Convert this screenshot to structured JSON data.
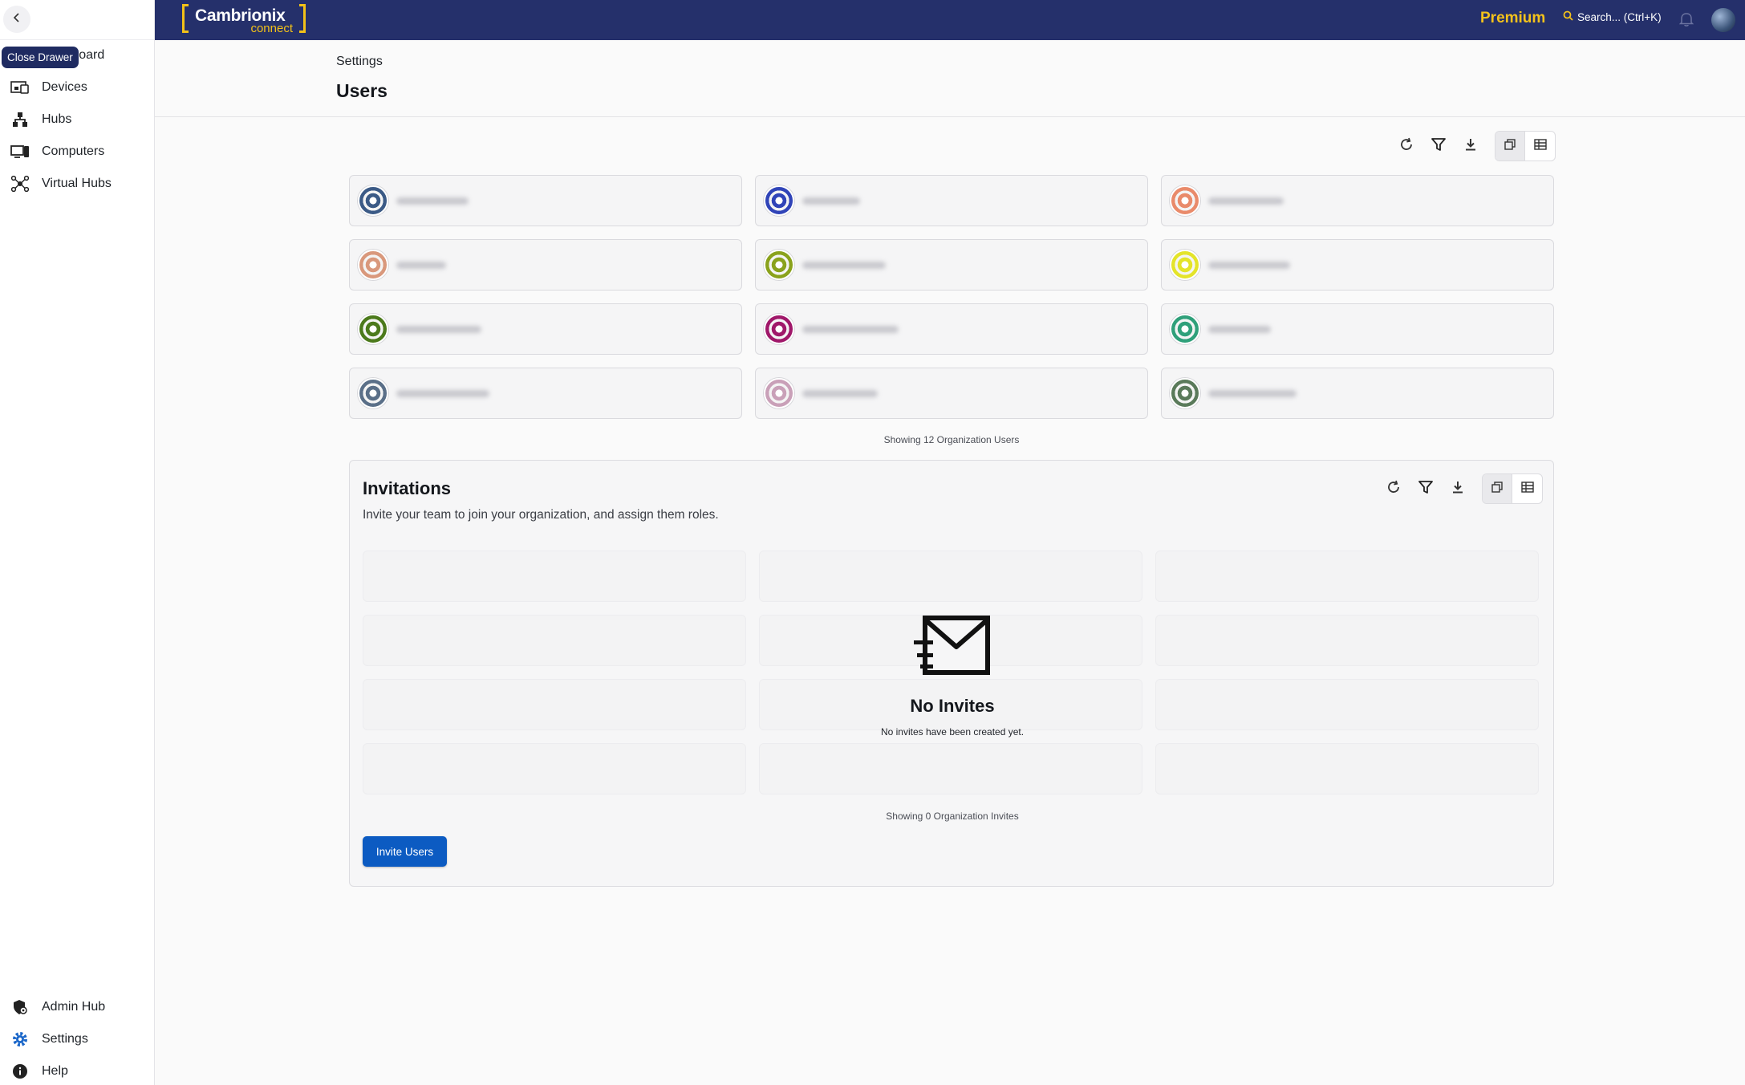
{
  "app": {
    "brand_name": "Cambrionix",
    "brand_sub": "connect",
    "plan": "Premium",
    "search_placeholder": "Search... (Ctrl+K)"
  },
  "sidebar": {
    "tooltip": "Close Drawer",
    "items": [
      {
        "label": "Dashboard",
        "icon": "dashboard-icon"
      },
      {
        "label": "Devices",
        "icon": "devices-icon"
      },
      {
        "label": "Hubs",
        "icon": "hubs-icon"
      },
      {
        "label": "Computers",
        "icon": "computers-icon"
      },
      {
        "label": "Virtual Hubs",
        "icon": "virtual-hubs-icon"
      }
    ],
    "bottom_items": [
      {
        "label": "Admin Hub",
        "icon": "admin-hub-icon"
      },
      {
        "label": "Settings",
        "icon": "settings-icon"
      },
      {
        "label": "Help",
        "icon": "help-icon"
      }
    ]
  },
  "page": {
    "breadcrumb": "Settings",
    "title": "Users"
  },
  "users": {
    "count_text": "Showing 12 Organization Users",
    "avatar_colors": [
      "#3b5a86",
      "#3044b8",
      "#e98a6a",
      "#d9987c",
      "#8aa21c",
      "#e4e42a",
      "#4c7a1c",
      "#a0186a",
      "#2fa07a",
      "#5a6f88",
      "#c9a0b8",
      "#5a7a5a"
    ]
  },
  "invitations": {
    "title": "Invitations",
    "description": "Invite your team to join your organization, and assign them roles.",
    "empty_title": "No Invites",
    "empty_subtitle": "No invites have been created yet.",
    "count_text": "Showing 0 Organization Invites",
    "invite_button": "Invite Users"
  },
  "colors": {
    "header_bg": "#25306b",
    "accent_yellow": "#f4c21b",
    "primary_button": "#0c5bc2"
  }
}
